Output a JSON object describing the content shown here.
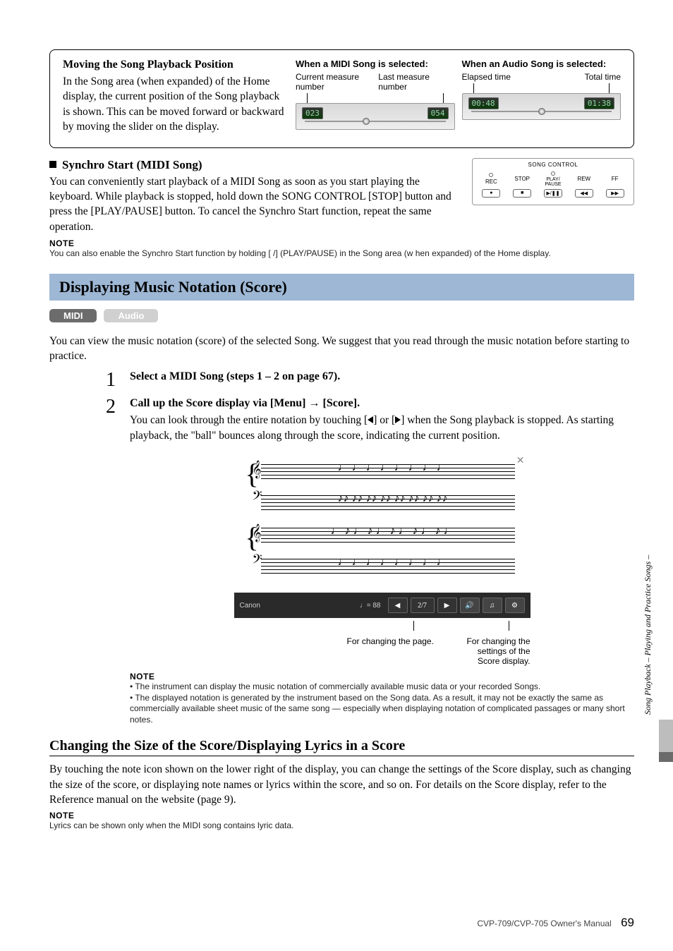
{
  "box1": {
    "title": "Moving the Song Playback Position",
    "body": "In the Song area (when expanded) of the Home display, the current position of the Song playback is shown. This can be moved forward or backward by moving the slider on the display.",
    "midi": {
      "head": "When a MIDI Song is selected:",
      "label_left": "Current measure number",
      "label_right": "Last measure number",
      "val_left": "023",
      "val_right": "054"
    },
    "audio": {
      "head": "When an Audio Song is selected:",
      "label_left": "Elapsed time",
      "label_right": "Total time",
      "val_left": "00:48",
      "val_right": "01:38"
    }
  },
  "synchro": {
    "title": "Synchro Start (MIDI Song)",
    "body": "You can conveniently start playback of a MIDI Song as soon as you start playing the keyboard. While playback is stopped, hold down the SONG CONTROL [STOP] button and press the [PLAY/PAUSE] button. To cancel the Synchro Start function, repeat the same operation.",
    "note_hd": "NOTE",
    "note_body": "You can also enable the Synchro Start function by holding [   /] (PLAY/PAUSE) in the Song area (w   hen expanded) of the Home display.",
    "panel": {
      "title": "SONG CONTROL",
      "rec": "REC",
      "stop": "STOP",
      "play": "PLAY/\nPAUSE",
      "rew": "REW",
      "ff": "FF"
    }
  },
  "bluebar": "Displaying Music Notation (Score)",
  "chips": {
    "midi": "MIDI",
    "audio": "Audio"
  },
  "intro": "You can view the music notation (score) of the selected Song. We suggest that you read through the music notation before starting to practice.",
  "step1": "Select a MIDI Song (steps 1 – 2 on page 67).",
  "step2": {
    "title_a": "Call up the Score display via [Menu] ",
    "title_b": " [Score].",
    "body_a": "You can look through the entire notation by touching [",
    "body_b": "] or [",
    "body_c": "] when the Song playback is stopped. As starting playback, the \"ball\" bounces along through the score, indicating the current position."
  },
  "score_ui": {
    "name": "Canon",
    "tempo": "♩= 88",
    "page": "2/7"
  },
  "score_captions": {
    "left": "For changing the page.",
    "right": "For changing the settings of the Score display."
  },
  "notes2": {
    "hd": "NOTE",
    "b1": "The instrument can display the music notation of commercially available music data or your recorded Songs.",
    "b2": "The displayed notation is generated by the instrument based on the Song data. As a result, it may not be exactly the same as commercially available sheet music of the same song — especially when displaying notation of complicated passages or many short notes."
  },
  "h2b": "Changing the Size of the Score/Displaying Lyrics in a Score",
  "para2": "By touching the note icon shown on the lower right of the display, you can change the settings of the Score display, such as changing the size of the score, or displaying note names or lyrics within the score, and so on. For details on the Score display, refer to the Reference manual on the website (page 9).",
  "notes3": {
    "hd": "NOTE",
    "body": "Lyrics can be shown only when the MIDI song contains lyric data."
  },
  "side": "Song Playback – Playing and Practice Songs –",
  "footer": {
    "manual": "CVP-709/CVP-705 Owner's Manual",
    "page": "69"
  }
}
